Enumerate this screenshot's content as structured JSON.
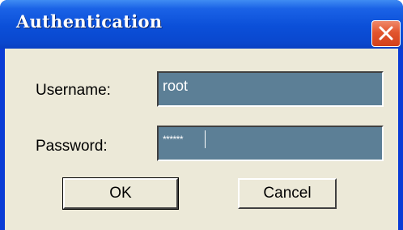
{
  "window": {
    "title": "Authentication"
  },
  "form": {
    "username_label": "Username:",
    "username_value": "root",
    "password_label": "Password:",
    "password_value": "******"
  },
  "buttons": {
    "ok_label": "OK",
    "cancel_label": "Cancel"
  },
  "colors": {
    "titlebar": "#0a48cf",
    "dialog_bg": "#ece9d8",
    "field_bg": "#5c7f96",
    "close_button": "#e2552e"
  },
  "icons": {
    "close": "close-icon"
  }
}
